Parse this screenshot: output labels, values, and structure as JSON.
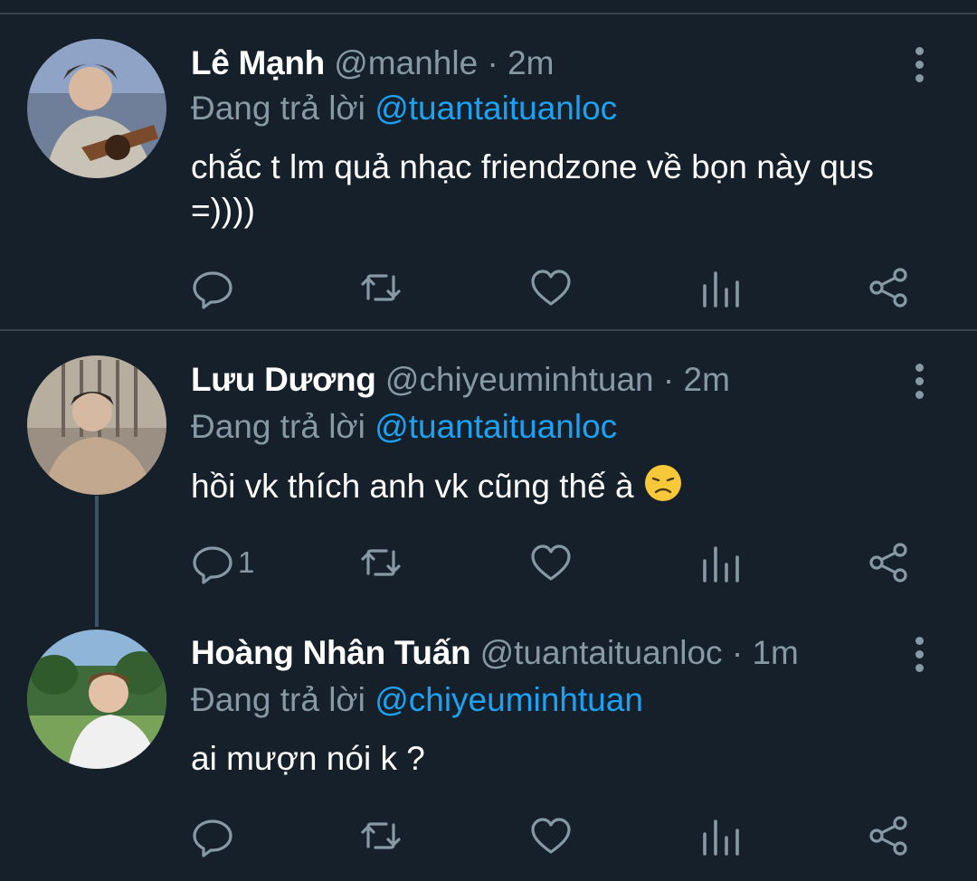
{
  "tweets": [
    {
      "name": "Lê Mạnh",
      "handle": "@manhle",
      "dot": "·",
      "time": "2m",
      "reply_prefix": "Đang trả lời",
      "reply_to": "@tuantaituanloc",
      "text": "chắc t lm quả nhạc friendzone về bọn này qus =))))",
      "reply_count": ""
    },
    {
      "name": "Lưu Dương",
      "handle": "@chiyeuminhtuan",
      "dot": "·",
      "time": "2m",
      "reply_prefix": "Đang trả lời",
      "reply_to": "@tuantaituanloc",
      "text": "hồi vk thích anh vk cũng thế à",
      "emoji": "disappointed-face-emoji",
      "reply_count": "1"
    },
    {
      "name": "Hoàng Nhân Tuấn",
      "handle": "@tuantaituanloc",
      "dot": "·",
      "time": "1m",
      "reply_prefix": "Đang trả lời",
      "reply_to": "@chiyeuminhtuan",
      "text": "ai mượn nói k ?",
      "reply_count": ""
    }
  ],
  "icons": {
    "reply": "reply-icon",
    "retweet": "retweet-icon",
    "like": "heart-icon",
    "analytics": "analytics-icon",
    "share": "share-icon",
    "more": "more-vertical-icon"
  },
  "colors": {
    "background": "#15202b",
    "secondary_text": "#8899a6",
    "link": "#1da1f2",
    "divider": "#38444d"
  }
}
